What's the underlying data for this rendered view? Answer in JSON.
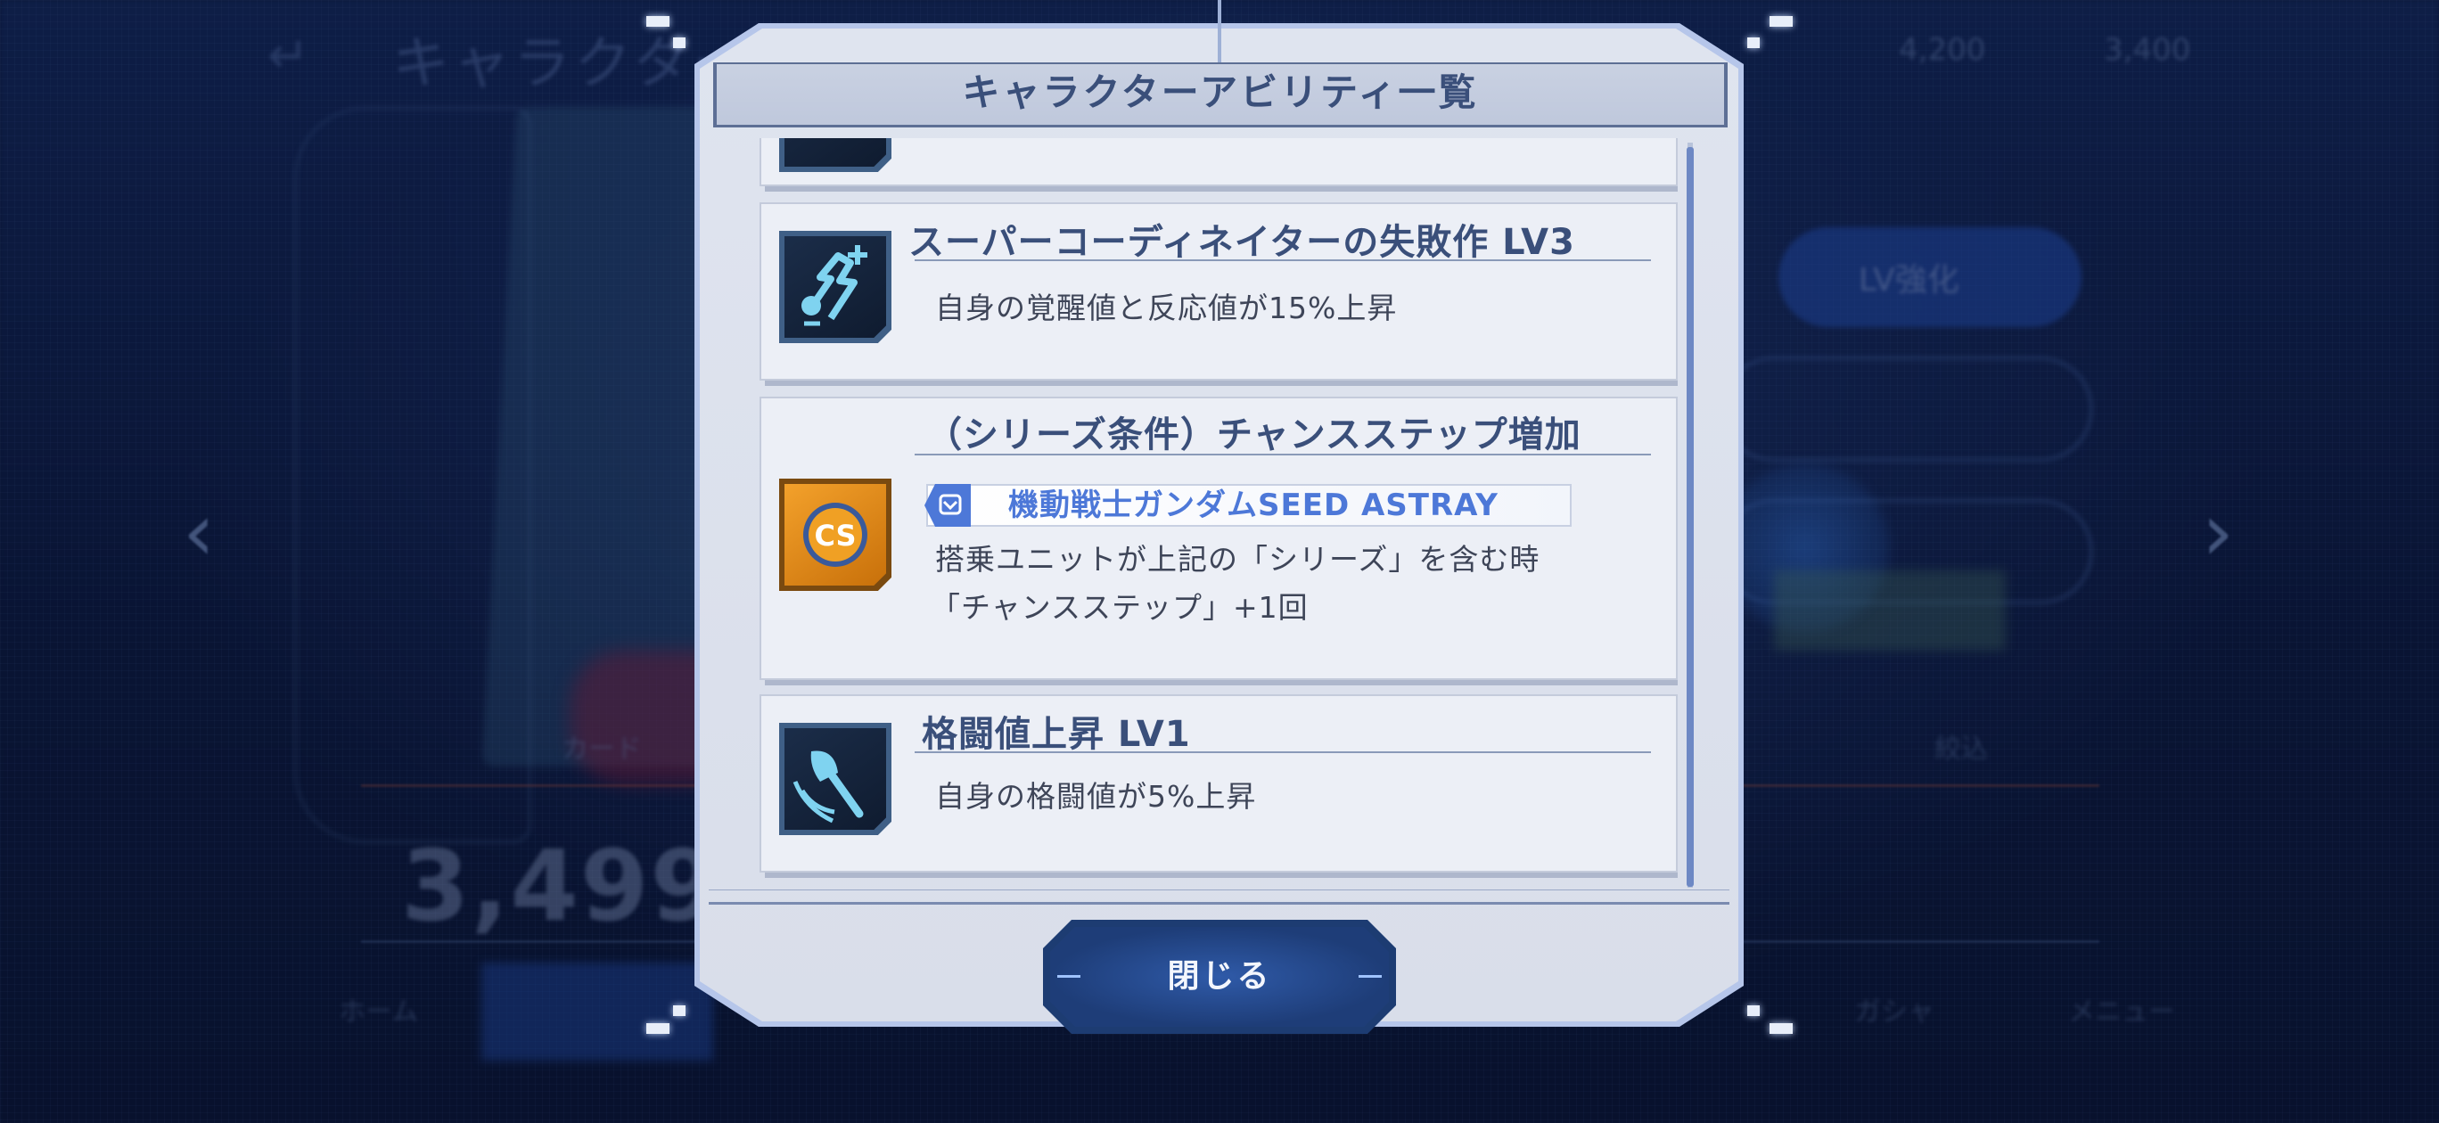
{
  "background": {
    "screen_title": "キャラクター",
    "back_icon": "back-arrow-icon",
    "currency_1": "4,200",
    "currency_2": "3,400",
    "lv_button": "LV強化",
    "power_value": "3,499",
    "card_label": "カード",
    "nav_home": "ホーム",
    "nav_gacha": "ガシャ",
    "nav_menu": "メニュー",
    "search_label": "絞込"
  },
  "modal": {
    "title": "キャラクターアビリティ一覧",
    "close_label": "閉じる",
    "abilities": [
      {
        "icon": "coordinator-icon",
        "title": "スーパーコーディネイターの失敗作 LV3",
        "desc": "自身の覚醒値と反応値が15%上昇"
      },
      {
        "icon": "cs-badge-icon",
        "icon_text": "CS",
        "title": "（シリーズ条件）チャンスステップ増加",
        "series": "機動戦士ガンダムSEED ASTRAY",
        "desc_1": "搭乗ユニットが上記の「シリーズ」を含む時",
        "desc_2": "「チャンスステップ」+1回"
      },
      {
        "icon": "melee-axe-icon",
        "title": "格闘値上昇 LV1",
        "desc": "自身の格闘値が5%上昇"
      }
    ]
  },
  "colors": {
    "accent": "#4d78d8",
    "title_text": "#3a4f7a",
    "button_bg": "#1e3d78",
    "cs_orange": "#e8890f"
  }
}
